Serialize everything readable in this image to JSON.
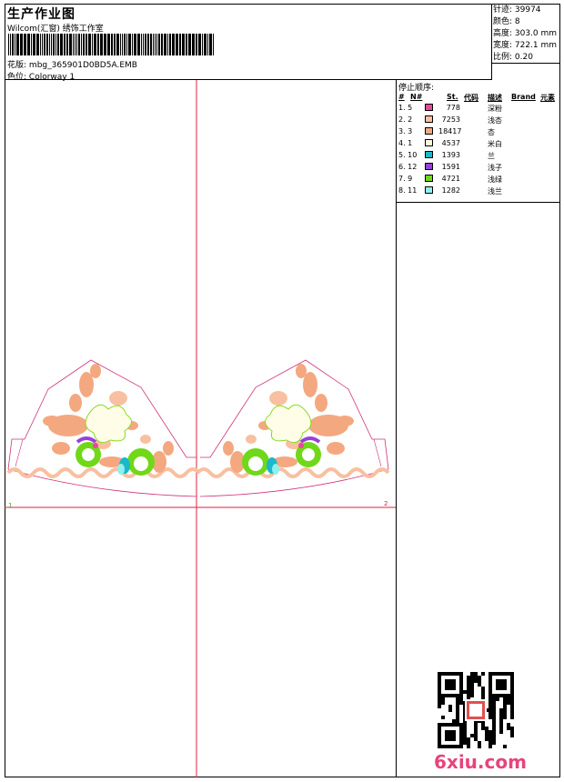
{
  "header": {
    "title": "生产作业图",
    "company": "Wilcom(汇窗) 绣饰工作室",
    "design_label": "花版:",
    "design_file": "mbg_365901D0BD5A.EMB",
    "colorway_label": "色位:",
    "colorway": "Colorway 1"
  },
  "stats": {
    "stitches": "针迹: 39974",
    "colors": "颜色: 8",
    "height": "高度: 303.0 mm",
    "width": "宽度: 722.1 mm",
    "scale": "比例: 0.20"
  },
  "stop_sequence": {
    "title": "停止顺序:",
    "columns": [
      "#",
      "N#",
      "St.",
      "代码",
      "描述",
      "Brand",
      "元素"
    ],
    "rows": [
      {
        "idx": "1. 5",
        "stitches": "778",
        "desc": "深粉",
        "color": "#e8489a"
      },
      {
        "idx": "2. 2",
        "stitches": "7253",
        "desc": "浅杏",
        "color": "#f8c0a0"
      },
      {
        "idx": "3. 3",
        "stitches": "18417",
        "desc": "杏",
        "color": "#f4a880"
      },
      {
        "idx": "4. 1",
        "stitches": "4537",
        "desc": "米白",
        "color": "#fcf8dc"
      },
      {
        "idx": "5. 10",
        "stitches": "1393",
        "desc": "兰",
        "color": "#1ab8c8"
      },
      {
        "idx": "6. 12",
        "stitches": "1591",
        "desc": "浅子",
        "color": "#9840d8"
      },
      {
        "idx": "7. 9",
        "stitches": "4721",
        "desc": "浅绿",
        "color": "#70d818"
      },
      {
        "idx": "8. 11",
        "stitches": "1282",
        "desc": "浅兰",
        "color": "#90f0f0"
      }
    ]
  },
  "watermark": {
    "brand": "6xiu.com"
  }
}
